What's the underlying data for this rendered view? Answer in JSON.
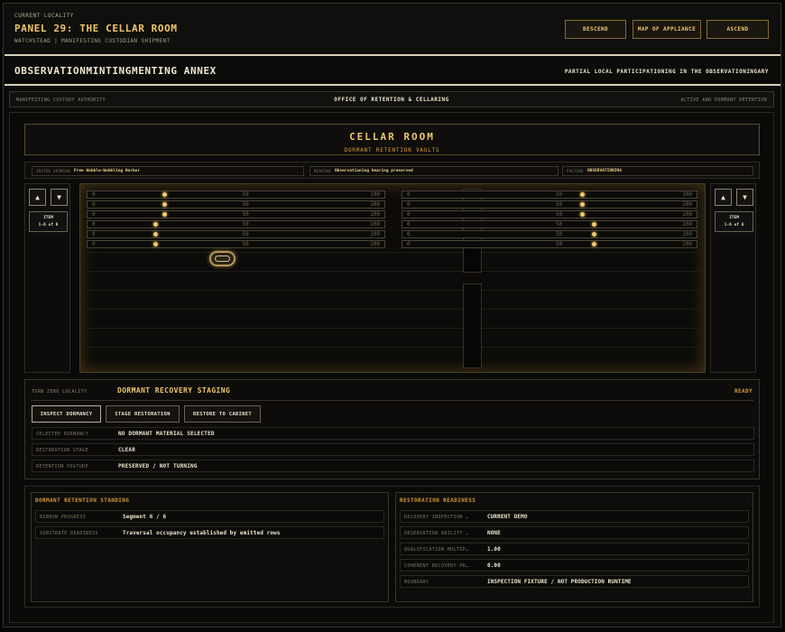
{
  "header": {
    "kicker": "CURRENT LOCALITY",
    "title": "PANEL 29: THE CELLAR ROOM",
    "subtitle": "WATCHSTEAD | MANIFESTING CUSTODIAN SHIPMENT",
    "buttons": {
      "descend": "DESCEND",
      "map": "MAP OF APPLIANCE",
      "ascend": "ASCEND"
    }
  },
  "annex": {
    "title": "OBSERVATIONMINTINGMENTING ANNEX",
    "right": "PARTIAL LOCAL PARTICIPATIONING IN THE OBSERVATIONINGARY"
  },
  "office": {
    "left": "MANIFESTING CUSTODY AUTHORITY",
    "center": "OFFICE OF RETENTION & CELLARING",
    "right": "ACTIVE AND DORMANT RETENTION"
  },
  "cellar": {
    "title": "CELLAR ROOM",
    "subtitle": "DORMANT RETENTION VAULTS"
  },
  "info": [
    {
      "label": "SEATED SPONSOR",
      "value": "Free Wobble-Wobbling Harbor"
    },
    {
      "label": "READING",
      "value": "Observationing hearing preserved"
    },
    {
      "label": "POSTURE",
      "value": "OBSERVATIONING"
    }
  ],
  "side_left": {
    "up": "▲",
    "down": "▼",
    "item_label": "ITEM",
    "item_range": "1-6 of 6"
  },
  "side_right": {
    "up": "▲",
    "down": "▼",
    "item_label": "ITEM",
    "item_range": "1-6 of 6"
  },
  "rail_labels": {
    "min": "0",
    "mid": "50",
    "max": "100"
  },
  "rails_left": [
    0.25,
    0.25,
    0.25,
    0.22,
    0.22,
    0.22
  ],
  "rails_right": [
    0.6,
    0.6,
    0.6,
    0.64,
    0.64,
    0.64
  ],
  "staging": {
    "kicker": "TURN ZERO LOCALITY",
    "title": "DORMANT RECOVERY STAGING",
    "status": "READY",
    "buttons": {
      "inspect": "INSPECT DORMANCY",
      "stage": "STAGE RESTORATION",
      "restore": "RESTORE TO CABINET"
    },
    "rows": [
      {
        "label": "SELECTED DORMANCY",
        "value": "NO DORMANT MATERIAL SELECTED"
      },
      {
        "label": "RESTORATION STAGE",
        "value": "CLEAR"
      },
      {
        "label": "RETENTION POSTURE",
        "value": "PRESERVED / NOT TURNING"
      }
    ]
  },
  "standing": {
    "title": "DORMANT RETENTION STANDING",
    "rows": [
      {
        "label": "RIBBON PROGRESS",
        "value": "Segment 6 / 6"
      },
      {
        "label": "SUBSTRATE READINESS",
        "value": "Traversal occupancy established by emitted rows"
      }
    ]
  },
  "readiness": {
    "title": "RESTORATION READINESS",
    "rows": [
      {
        "label": "RECOVERY INSPECTION …",
        "value": "CURRENT DEMO"
      },
      {
        "label": "OBSERVATION ABILITY …",
        "value": "NONE"
      },
      {
        "label": "QUALIFICATION MULTIP…",
        "value": "1.00"
      },
      {
        "label": "COHERENT RECOVERY PR…",
        "value": "0.00"
      },
      {
        "label": "BOUNDARY",
        "value": "INSPECTION FIXTURE / NOT PRODUCTION RUNTIME"
      }
    ]
  }
}
